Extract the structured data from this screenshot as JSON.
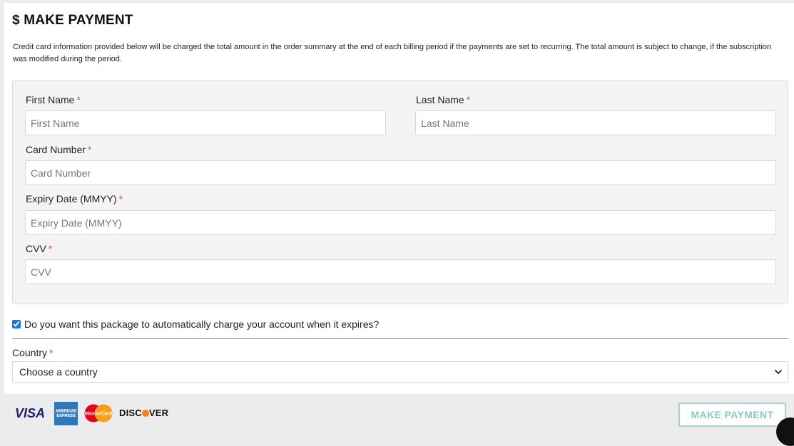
{
  "header": {
    "title": "$ MAKE PAYMENT",
    "description": "Credit card information provided below will be charged the total amount in the order summary at the end of each billing period if the payments are set to recurring. The total amount is subject to change, if the subscription was modified during the period."
  },
  "form": {
    "required_marker": "*",
    "first_name": {
      "label": "First Name",
      "placeholder": "First Name",
      "value": ""
    },
    "last_name": {
      "label": "Last Name",
      "placeholder": "Last Name",
      "value": ""
    },
    "card_number": {
      "label": "Card Number",
      "placeholder": "Card Number",
      "value": ""
    },
    "expiry": {
      "label": "Expiry Date (MMYY)",
      "placeholder": "Expiry Date (MMYY)",
      "value": ""
    },
    "cvv": {
      "label": "CVV",
      "placeholder": "CVV",
      "value": ""
    }
  },
  "auto_charge": {
    "label": "Do you want this package to automatically charge your account when it expires?",
    "checked": true
  },
  "country": {
    "label": "Country",
    "selected": "Choose a country"
  },
  "footer": {
    "card_logos": [
      {
        "name": "visa-logo",
        "text": "VISA",
        "color": "#1a1f71"
      },
      {
        "name": "amex-logo",
        "text": "AMERICAN EXPRESS",
        "color": "#2e77bb"
      },
      {
        "name": "mastercard-logo",
        "text": "MasterCard",
        "colors": [
          "#eb001b",
          "#f79e1b"
        ]
      },
      {
        "name": "discover-logo",
        "text": "DISCOVER",
        "accent": "#f58220"
      }
    ],
    "pay_button": "MAKE PAYMENT"
  },
  "colors": {
    "accent": "#8dc7c5",
    "required": "#d9534f",
    "checkbox": "#1a73e8"
  }
}
